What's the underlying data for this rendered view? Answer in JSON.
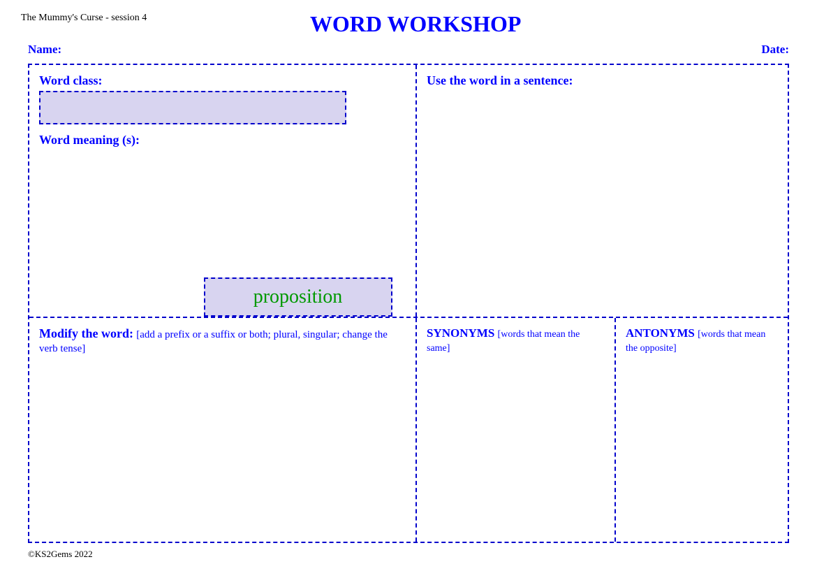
{
  "header": {
    "session": "The Mummy's Curse - session 4",
    "title": "WORD WORKSHOP",
    "name_label": "Name:",
    "date_label": "Date:"
  },
  "left_panel": {
    "word_class_label": "Word class:",
    "word_meaning_label": "Word meaning (s):"
  },
  "right_panel": {
    "use_sentence_label": "Use the word in a sentence:"
  },
  "center_word": {
    "word": "proposition"
  },
  "bottom": {
    "modify_label": "Modify the word:",
    "modify_sub": "[add a prefix or a suffix or both; plural, singular; change the verb tense]",
    "synonyms_label": "SYNONYMS",
    "synonyms_sub": "[words that mean the same]",
    "antonyms_label": "ANTONYMS",
    "antonyms_sub": "[words that mean the opposite]"
  },
  "footer": {
    "copyright": "©KS2Gems 2022"
  }
}
